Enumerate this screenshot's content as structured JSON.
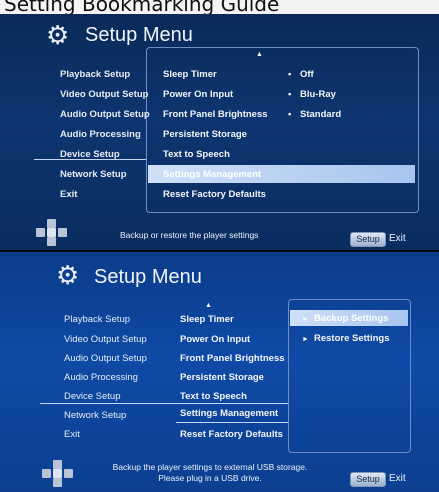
{
  "caption": "Setting Bookmarking Guide",
  "screen1": {
    "title": "Setup Menu",
    "left_menu": [
      "Playback Setup",
      "Video Output Setup",
      "Audio Output Setup",
      "Audio Processing",
      "Device Setup",
      "Network Setup",
      "Exit"
    ],
    "middle_menu": [
      "Sleep Timer",
      "Power On Input",
      "Front Panel Brightness",
      "Persistent Storage",
      "Text to Speech",
      "Settings Management",
      "Reset Factory Defaults"
    ],
    "values": [
      "Off",
      "Blu-Ray",
      "Standard"
    ],
    "bullet": "•",
    "hint": "Backup or restore the player settings",
    "setup_button": "Setup",
    "exit_label": "Exit"
  },
  "screen2": {
    "title": "Setup Menu",
    "left_menu": [
      "Playback Setup",
      "Video Output Setup",
      "Audio Output Setup",
      "Audio Processing",
      "Device Setup",
      "Network Setup",
      "Exit"
    ],
    "middle_menu": [
      "Sleep Timer",
      "Power On Input",
      "Front Panel Brightness",
      "Persistent Storage",
      "Text to Speech",
      "Settings Management",
      "Reset Factory Defaults"
    ],
    "submenu": [
      "Backup Settings",
      "Restore Settings"
    ],
    "submenu_marker": "►",
    "hint_line1": "Backup the player settings to external USB storage.",
    "hint_line2": "Please plug in a USB drive.",
    "setup_button": "Setup",
    "exit_label": "Exit"
  },
  "colors": {
    "highlight": "#cfe0f8",
    "background": "#0d3570",
    "text": "#f4f6fb"
  },
  "icons": [
    "gear-icon",
    "dpad-icon",
    "scroll-up-arrow-icon"
  ]
}
